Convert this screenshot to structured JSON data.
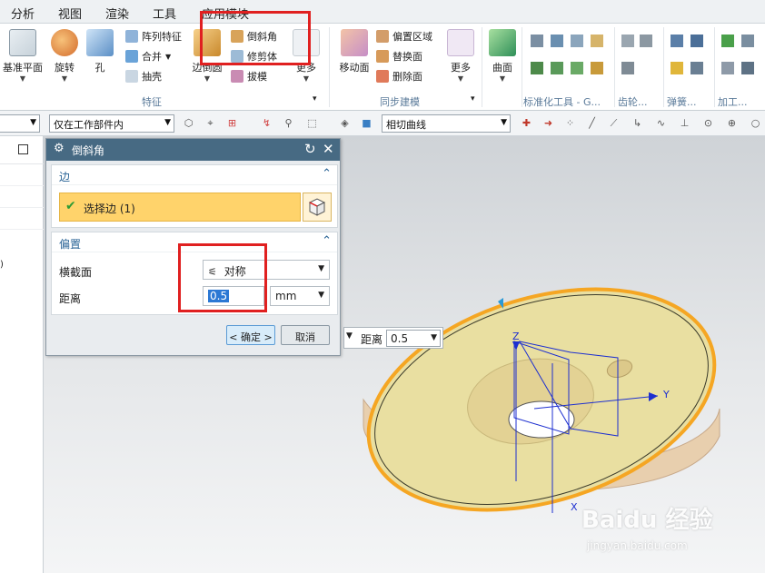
{
  "menubar": {
    "items": [
      "分析",
      "视图",
      "渲染",
      "工具",
      "应用模块"
    ]
  },
  "ribbon": {
    "large_buttons": [
      "基准平面",
      "旋转",
      "孔",
      "边倒圆",
      "更多",
      "移动面",
      "更多",
      "曲面"
    ],
    "small_buttons": [
      "阵列特征",
      "合并",
      "抽壳",
      "倒斜角",
      "修剪体",
      "拔模",
      "偏置区域",
      "替换面",
      "删除面"
    ],
    "groups": [
      "特征",
      "同步建模",
      "标准化工具 - G...",
      "齿轮...",
      "弹簧...",
      "加工..."
    ]
  },
  "toolbar2": {
    "scope_value": "仅在工作部件内",
    "curve_rule_value": "相切曲线"
  },
  "dialog": {
    "title": "倒斜角",
    "edge_section": {
      "title": "边",
      "select_label": "选择边 (1)"
    },
    "offset_section": {
      "title": "偏置",
      "cross_section_label": "横截面",
      "cross_section_value": "对称",
      "distance_label": "距离",
      "distance_value": "0.5",
      "unit": "mm"
    },
    "ok_label": "< 确定 >",
    "cancel_label": "取消"
  },
  "floating_input": {
    "label": "距离",
    "value": "0.5"
  },
  "viewport": {
    "axis_x": "X",
    "axis_y": "Y",
    "axis_z": "Z"
  },
  "watermark": {
    "brand": "Baidu 经验",
    "url": "jingyan.baidu.com"
  },
  "colors": {
    "highlight_red": "#e02020",
    "dialog_title": "#476a83",
    "selection_yellow": "#ffd36b",
    "section_blue": "#2a6496",
    "edge_orange": "#f5a623"
  }
}
